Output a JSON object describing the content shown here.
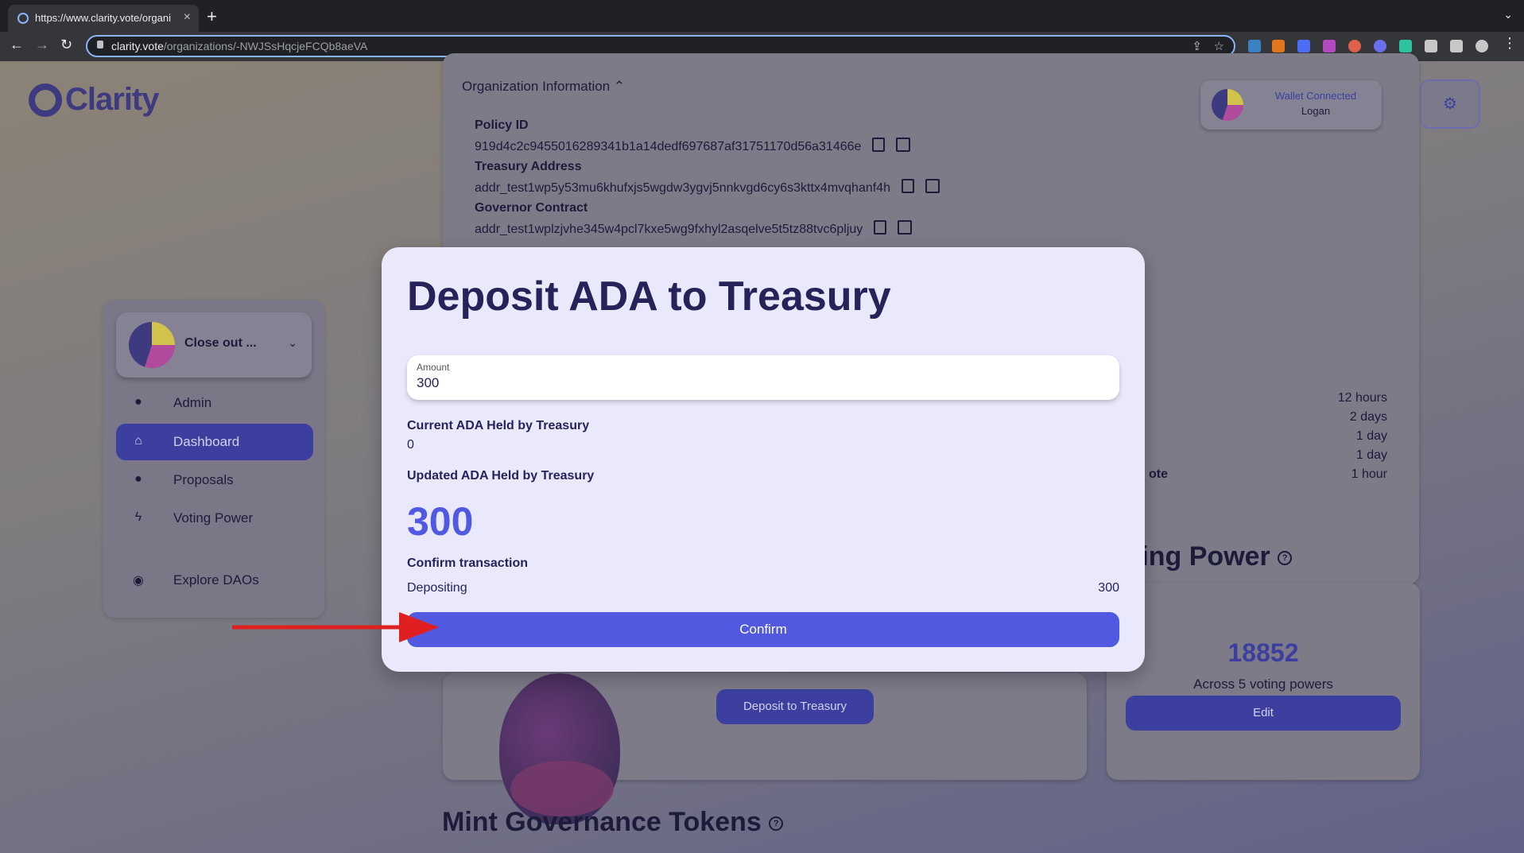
{
  "browser": {
    "tab_title": "https://www.clarity.vote/organi",
    "url_host": "clarity.vote",
    "url_path": "/organizations/-NWJSsHqcjeFCQb8aeVA"
  },
  "app": {
    "logo_text": "Clarity"
  },
  "sidebar": {
    "org_name": "Close out ...",
    "items": [
      {
        "label": "Admin",
        "icon": "person-icon"
      },
      {
        "label": "Dashboard",
        "icon": "home-icon"
      },
      {
        "label": "Proposals",
        "icon": "lightbulb-icon"
      },
      {
        "label": "Voting Power",
        "icon": "bolt-icon"
      },
      {
        "label": "Explore DAOs",
        "icon": "compass-icon"
      }
    ]
  },
  "org_info": {
    "heading": "Organization Information",
    "policy_label": "Policy ID",
    "policy_value": "919d4c2c9455016289341b1a14dedf697687af31751170d56a31466e",
    "treasury_label": "Treasury Address",
    "treasury_value": "addr_test1wp5y53mu6khufxjs5wgdw3ygvj5nnkvgd6cy6s3kttx4mvqhanf4h",
    "governor_label": "Governor Contract",
    "governor_value": "addr_test1wplzjvhe345w4pcl7kxe5wg9fxhyl2asqelve5t5tz88tvc6pljuy",
    "durations": [
      "12 hours",
      "2 days",
      "1 day",
      "1 day",
      "1 hour"
    ],
    "partial_label": "ote"
  },
  "wallet": {
    "status": "Wallet Connected",
    "name": "Logan"
  },
  "voting_power": {
    "title_partial": "ting Power",
    "total": "18852",
    "subtitle": "Across 5 voting powers",
    "edit_label": "Edit"
  },
  "treasury": {
    "deposit_button": "Deposit to Treasury"
  },
  "mint": {
    "title": "Mint Governance Tokens"
  },
  "modal": {
    "title": "Deposit ADA to Treasury",
    "amount_label": "Amount",
    "amount_value": "300",
    "current_label": "Current ADA Held by Treasury",
    "current_value": "0",
    "updated_label": "Updated ADA Held by Treasury",
    "updated_value": "300",
    "confirm_section": "Confirm transaction",
    "depositing_label": "Depositing",
    "depositing_value": "300",
    "confirm_button": "Confirm"
  },
  "colors": {
    "accent": "#5059e0",
    "brand_dark": "#3d3a80",
    "annotation_arrow": "#e02020"
  }
}
